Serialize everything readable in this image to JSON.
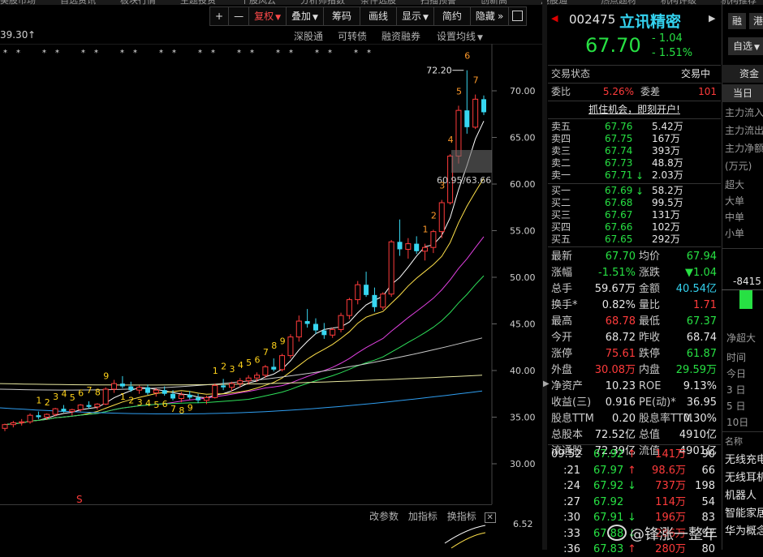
{
  "top_menu": [
    "美股市场",
    "自选资讯",
    "板块行情",
    "主题投资",
    "个股风云",
    "分析师指数",
    "条件选股",
    "扫描预警",
    "创新高",
    "港股通",
    "热点题材",
    "机构评级",
    "机构推荐"
  ],
  "toolbar": {
    "plus": "+",
    "minus": "—",
    "restore": "复权",
    "overlay": "叠加",
    "chips": "筹码",
    "draw": "画线",
    "display": "显示",
    "simple": "简约",
    "hide": "隐藏",
    "more": "»"
  },
  "subbar": {
    "price_left": "39.30",
    "up_arrow": "↑",
    "links": [
      "深股通",
      "可转债",
      "融资融券",
      "设置均线"
    ]
  },
  "chart_data": {
    "type": "candlestick",
    "y_ticks": [
      "70.00",
      "65.00",
      "60.00",
      "55.00",
      "50.00",
      "45.00",
      "40.00",
      "35.00",
      "30.00"
    ],
    "ylim": [
      28.5,
      74.0
    ],
    "high_label": "72.20",
    "cursor_labels": [
      "60.95",
      "63.66"
    ],
    "td_numbers_left": [
      "1",
      "2",
      "3",
      "4",
      "5",
      "6",
      "7",
      "8",
      "9"
    ],
    "td_numbers_mid": [
      "1",
      "2",
      "3",
      "4",
      "5",
      "6",
      "7",
      "8",
      "9"
    ],
    "td_numbers_green": [
      "1",
      "2",
      "3",
      "4",
      "5",
      "6",
      "7",
      "8",
      "9"
    ],
    "td_numbers_top": [
      "1",
      "2",
      "3",
      "4",
      "5",
      "6",
      "7"
    ],
    "mark_s": "S",
    "candles": [
      [
        33.8,
        34.3,
        33.5,
        34.2
      ],
      [
        34.2,
        34.6,
        33.9,
        34.4
      ],
      [
        34.4,
        34.8,
        34.1,
        34.5
      ],
      [
        34.5,
        35.4,
        34.3,
        35.2
      ],
      [
        35.2,
        35.6,
        34.8,
        35.0
      ],
      [
        35.0,
        35.4,
        34.7,
        35.3
      ],
      [
        35.3,
        36.0,
        35.1,
        35.9
      ],
      [
        35.9,
        36.3,
        35.5,
        35.6
      ],
      [
        35.6,
        35.9,
        35.2,
        35.8
      ],
      [
        35.8,
        36.4,
        35.6,
        36.3
      ],
      [
        36.3,
        36.7,
        35.9,
        36.1
      ],
      [
        36.1,
        36.5,
        35.8,
        36.4
      ],
      [
        36.4,
        38.2,
        36.3,
        38.0
      ],
      [
        38.0,
        39.0,
        37.6,
        38.6
      ],
      [
        38.6,
        39.4,
        38.1,
        38.3
      ],
      [
        38.3,
        38.8,
        37.7,
        37.9
      ],
      [
        37.9,
        38.4,
        37.5,
        38.2
      ],
      [
        38.2,
        38.5,
        37.4,
        37.6
      ],
      [
        37.6,
        38.1,
        37.2,
        37.9
      ],
      [
        37.9,
        38.3,
        37.3,
        37.5
      ],
      [
        37.5,
        37.9,
        36.8,
        37.0
      ],
      [
        37.0,
        37.7,
        36.6,
        37.4
      ],
      [
        37.4,
        37.8,
        36.9,
        37.1
      ],
      [
        37.1,
        37.5,
        36.5,
        36.8
      ],
      [
        36.8,
        37.3,
        36.4,
        37.1
      ],
      [
        37.1,
        38.6,
        37.0,
        38.4
      ],
      [
        38.4,
        39.1,
        37.9,
        38.2
      ],
      [
        38.2,
        38.8,
        37.8,
        38.6
      ],
      [
        38.6,
        39.2,
        38.2,
        38.9
      ],
      [
        38.9,
        39.5,
        38.5,
        39.2
      ],
      [
        39.2,
        39.8,
        38.8,
        39.5
      ],
      [
        39.5,
        40.6,
        39.2,
        40.4
      ],
      [
        40.4,
        41.3,
        39.9,
        40.1
      ],
      [
        40.1,
        41.8,
        39.9,
        41.6
      ],
      [
        41.6,
        43.9,
        41.3,
        43.6
      ],
      [
        43.6,
        45.9,
        43.1,
        45.3
      ],
      [
        45.3,
        46.6,
        44.6,
        45.0
      ],
      [
        45.0,
        45.6,
        43.9,
        44.3
      ],
      [
        44.3,
        45.1,
        43.4,
        43.8
      ],
      [
        43.8,
        44.6,
        43.5,
        44.4
      ],
      [
        44.4,
        46.2,
        44.1,
        45.9
      ],
      [
        45.9,
        47.8,
        45.5,
        47.6
      ],
      [
        47.6,
        49.6,
        47.1,
        49.2
      ],
      [
        49.2,
        50.6,
        47.9,
        48.1
      ],
      [
        48.1,
        48.9,
        46.3,
        46.8
      ],
      [
        46.8,
        48.4,
        46.5,
        48.2
      ],
      [
        48.2,
        54.0,
        47.9,
        53.8
      ],
      [
        53.8,
        56.2,
        52.3,
        53.0
      ],
      [
        53.0,
        54.2,
        52.0,
        53.6
      ],
      [
        53.6,
        54.4,
        52.5,
        52.8
      ],
      [
        52.8,
        53.6,
        51.8,
        53.2
      ],
      [
        53.2,
        55.1,
        52.6,
        54.9
      ],
      [
        54.9,
        58.3,
        54.2,
        58.0
      ],
      [
        58.0,
        63.2,
        57.8,
        63.0
      ],
      [
        63.0,
        68.4,
        62.2,
        67.9
      ],
      [
        67.9,
        72.2,
        65.4,
        66.1
      ],
      [
        66.1,
        69.6,
        65.9,
        69.1
      ],
      [
        69.1,
        69.5,
        67.4,
        67.7
      ]
    ]
  },
  "lower_panel": {
    "links": [
      "改参数",
      "加指标",
      "换指标"
    ],
    "close_icon": "✕",
    "y_tick": "6.52"
  },
  "stock": {
    "code": "002475",
    "name": "立讯精密",
    "price": "67.70",
    "change": "- 1.04",
    "change_pct": "- 1.51%",
    "btn_rong": "融",
    "btn_gang": "港",
    "btn_watch": "自选"
  },
  "status": {
    "label": "交易状态",
    "value": "交易中"
  },
  "ratio": {
    "weibi_label": "委比",
    "weibi": "5.26%",
    "weicha_label": "委差",
    "weicha": "101"
  },
  "promo": "抓住机会，即刻开户!",
  "asks": [
    {
      "label": "卖五",
      "price": "67.76",
      "vol": "5.42万"
    },
    {
      "label": "卖四",
      "price": "67.75",
      "vol": "167万"
    },
    {
      "label": "卖三",
      "price": "67.74",
      "vol": "393万"
    },
    {
      "label": "卖二",
      "price": "67.73",
      "vol": "48.8万"
    },
    {
      "label": "卖一",
      "price": "67.71",
      "vol": "2.03万"
    }
  ],
  "bids": [
    {
      "label": "买一",
      "price": "67.69",
      "vol": "58.2万"
    },
    {
      "label": "买二",
      "price": "67.68",
      "vol": "99.5万"
    },
    {
      "label": "买三",
      "price": "67.67",
      "vol": "131万"
    },
    {
      "label": "买四",
      "price": "67.66",
      "vol": "102万"
    },
    {
      "label": "买五",
      "price": "67.65",
      "vol": "292万"
    }
  ],
  "stats": [
    {
      "l1": "最新",
      "v1": "67.70",
      "l2": "均价",
      "v2": "67.94"
    },
    {
      "l1": "涨幅",
      "v1": "-1.51%",
      "l2": "涨跌",
      "v2": "▼1.04"
    },
    {
      "l1": "总手",
      "v1": "59.67万",
      "l2": "金额",
      "v2": "40.54亿"
    },
    {
      "l1": "换手*",
      "v1": "0.82%",
      "l2": "量比",
      "v2": "1.71"
    },
    {
      "l1": "最高",
      "v1": "68.78",
      "l2": "最低",
      "v2": "67.37"
    },
    {
      "l1": "今开",
      "v1": "68.72",
      "l2": "昨收",
      "v2": "68.74"
    },
    {
      "l1": "涨停",
      "v1": "75.61",
      "l2": "跌停",
      "v2": "61.87"
    },
    {
      "l1": "外盘",
      "v1": "30.08万",
      "l2": "内盘",
      "v2": "29.59万"
    },
    {
      "l1": "净资产",
      "v1": "10.23",
      "l2": "ROE",
      "v2": "9.13%"
    },
    {
      "l1": "收益(三)",
      "v1": "0.916",
      "l2": "PE(动)*",
      "v2": "36.95"
    },
    {
      "l1": "股息TTM",
      "v1": "0.20",
      "l2": "股息率TTM",
      "v2": "0.30%"
    },
    {
      "l1": "总股本",
      "v1": "72.52亿",
      "l2": "总值",
      "v2": "4910亿"
    },
    {
      "l1": "流通股",
      "v1": "72.39亿",
      "l2": "流值",
      "v2": "4901亿"
    }
  ],
  "ticks": [
    {
      "time": "09:52",
      "price": "67.92",
      "dir": "↑",
      "vol": "141万",
      "n": "90"
    },
    {
      "time": ":21",
      "price": "67.97",
      "dir": "↑",
      "vol": "98.6万",
      "n": "66"
    },
    {
      "time": ":24",
      "price": "67.92",
      "dir": "↓",
      "vol": "737万",
      "n": "198"
    },
    {
      "time": ":27",
      "price": "67.92",
      "dir": "",
      "vol": "114万",
      "n": "54"
    },
    {
      "time": ":30",
      "price": "67.91",
      "dir": "↓",
      "vol": "196万",
      "n": "83"
    },
    {
      "time": ":33",
      "price": "67.88",
      "dir": "↓",
      "vol": "286万",
      "n": "97"
    },
    {
      "time": ":36",
      "price": "67.83",
      "dir": "↑",
      "vol": "280万",
      "n": "80"
    }
  ],
  "far_right": {
    "tab_zijin": "资金",
    "tab_dangri": "当日",
    "rows": [
      "主力流入",
      "主力流出",
      "主力净额"
    ],
    "unit": "(万元)",
    "sizes": [
      "超大",
      "大单",
      "中单",
      "小单"
    ],
    "bar_value": "-8415",
    "net_label": "净超大",
    "time_label": "时间",
    "periods": [
      "今日",
      "3 日",
      "5 日",
      "10日"
    ],
    "name_label": "名称",
    "concepts": [
      "无线充电",
      "无线耳机",
      "机器人",
      "智能家居",
      "华为概念"
    ]
  },
  "watermark": "@锋涨一整年"
}
